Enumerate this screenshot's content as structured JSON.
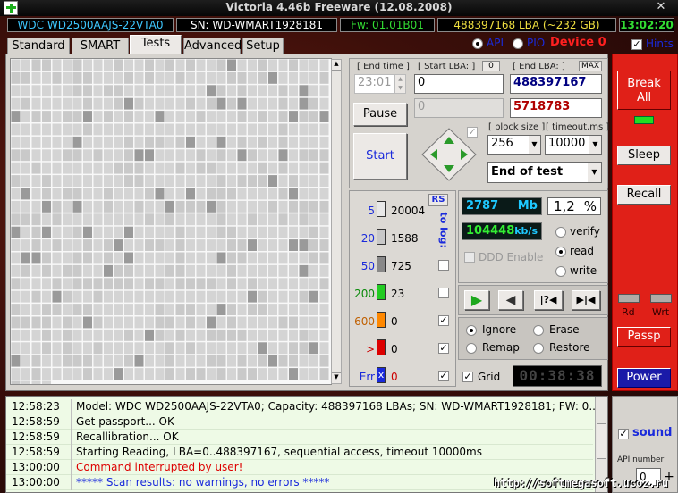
{
  "window": {
    "title": "Victoria 4.46b Freeware (12.08.2008)",
    "close": "✕"
  },
  "infobar": {
    "model": "WDC WD2500AAJS-22VTA0",
    "serial": "SN: WD-WMART1928181",
    "firmware": "Fw: 01.01B01",
    "lba": "488397168 LBA (~232 GB)",
    "time": "13:02:20"
  },
  "tabs": [
    "Standard",
    "SMART",
    "Tests",
    "Advanced",
    "Setup"
  ],
  "active_tab": "Tests",
  "mode": {
    "api": "API",
    "pio": "PIO",
    "device": "Device 0",
    "hints": "Hints"
  },
  "test": {
    "end_time_label": "[ End time ]",
    "end_time": "23:01",
    "start_lba_label": "[ Start LBA: ]",
    "start_lba_zero": "0",
    "start_lba": "0",
    "end_lba_label": "[ End LBA: ]",
    "max_label": "MAX",
    "end_lba": "488397167",
    "current_lba": "5718783",
    "pause": "Pause",
    "start": "Start",
    "block_size_label": "[ block size ]",
    "block_size": "256",
    "timeout_label": "[ timeout,ms ]",
    "timeout": "10000",
    "end_action": "End of test"
  },
  "stats": {
    "rs": "RS",
    "to_log": "to log:",
    "rows": [
      {
        "label": "5",
        "value": "20004",
        "color": "#e8e8e8",
        "checked": false
      },
      {
        "label": "20",
        "value": "1588",
        "color": "#c8c8c8",
        "checked": false
      },
      {
        "label": "50",
        "value": "725",
        "color": "#888888",
        "checked": false
      },
      {
        "label": "200",
        "value": "23",
        "color": "#22cc22",
        "checked": false
      },
      {
        "label": "600",
        "value": "0",
        "color": "#ff8800",
        "checked": true
      },
      {
        "label": ">",
        "value": "0",
        "color": "#dd0000",
        "checked": true
      },
      {
        "label": "Err",
        "value": "0",
        "color": "#1a2adb",
        "checked": true
      }
    ],
    "err_mark": "x"
  },
  "progress": {
    "mb": "2787",
    "mb_unit": "Mb",
    "percent": "1,2",
    "percent_unit": "%",
    "speed": "104448",
    "speed_unit": "kb/s",
    "ddd": "DDD Enable",
    "verify": "verify",
    "read": "read",
    "write": "write",
    "transport": [
      "▶",
      "◀",
      "|?◀",
      "▶|◀"
    ]
  },
  "actions": {
    "ignore": "Ignore",
    "erase": "Erase",
    "remap": "Remap",
    "restore": "Restore",
    "grid": "Grid",
    "timer": "00:38:38"
  },
  "side": {
    "break": "Break All",
    "sleep": "Sleep",
    "recall": "Recall",
    "rd": "Rd",
    "wrt": "Wrt",
    "passp": "Passp",
    "power": "Power",
    "sound": "sound",
    "api_number": "API number",
    "api_value": "0"
  },
  "log": [
    {
      "time": "12:58:23",
      "msg": "Model: WDC WD2500AAJS-22VTA0; Capacity: 488397168 LBAs; SN: WD-WMART1928181; FW: 0...",
      "color": "#000000"
    },
    {
      "time": "12:58:59",
      "msg": "Get passport... OK",
      "color": "#000000"
    },
    {
      "time": "12:58:59",
      "msg": "Recallibration... OK",
      "color": "#000000"
    },
    {
      "time": "12:58:59",
      "msg": "Starting Reading, LBA=0..488397167, sequential access, timeout 10000ms",
      "color": "#000000"
    },
    {
      "time": "13:00:00",
      "msg": "Command interrupted by user!",
      "color": "#dd0000"
    },
    {
      "time": "13:00:00",
      "msg": "***** Scan results: no warnings, no errors *****",
      "color": "#1a2adb"
    }
  ],
  "watermark": "http://softmegasoft.ucoz.ru"
}
